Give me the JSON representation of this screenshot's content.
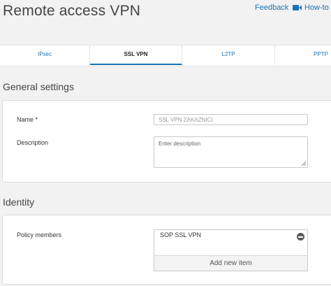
{
  "header": {
    "title": "Remote access VPN",
    "feedback_label": "Feedback",
    "howto_label": "How-to g",
    "howto_icon": "video-camera-icon"
  },
  "tabs": [
    {
      "label": "IPsec",
      "active": false
    },
    {
      "label": "SSL VPN",
      "active": true
    },
    {
      "label": "L2TP",
      "active": false
    },
    {
      "label": "PPTP",
      "active": false
    }
  ],
  "general": {
    "section_title": "General settings",
    "name_label": "Name *",
    "name_value": "SSL VPN ZAKAZNICI",
    "description_label": "Description",
    "description_placeholder": "Enter description"
  },
  "identity": {
    "section_title": "Identity",
    "policy_members_label": "Policy members",
    "members": [
      "SOP SSL VPN"
    ],
    "add_new_label": "Add new item"
  },
  "colors": {
    "accent": "#1a73b5",
    "background": "#f2f2f2"
  }
}
